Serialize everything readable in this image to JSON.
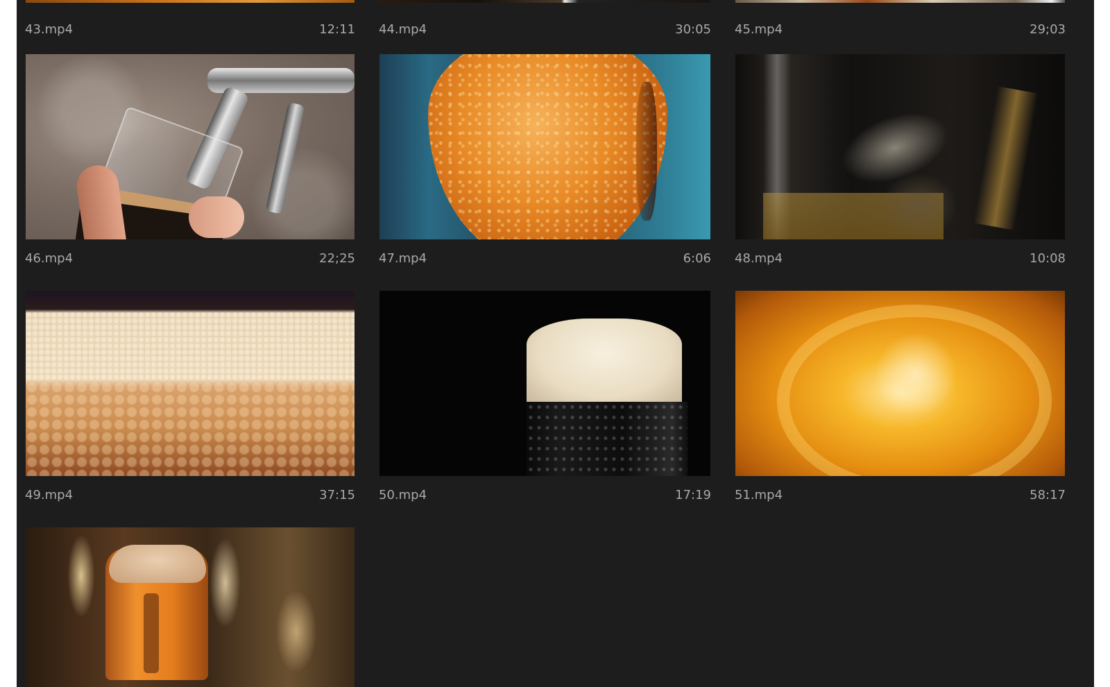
{
  "clips": [
    {
      "name": "43.mp4",
      "duration": "12:11"
    },
    {
      "name": "44.mp4",
      "duration": "30:05"
    },
    {
      "name": "45.mp4",
      "duration": "29;03"
    },
    {
      "name": "46.mp4",
      "duration": "22;25"
    },
    {
      "name": "47.mp4",
      "duration": "6:06"
    },
    {
      "name": "48.mp4",
      "duration": "10:08"
    },
    {
      "name": "49.mp4",
      "duration": "37:15"
    },
    {
      "name": "50.mp4",
      "duration": "17:19"
    },
    {
      "name": "51.mp4",
      "duration": "58:17"
    }
  ],
  "theme": {
    "panel_bg": "#1d1d1d",
    "text_color": "#a9a9a9"
  }
}
